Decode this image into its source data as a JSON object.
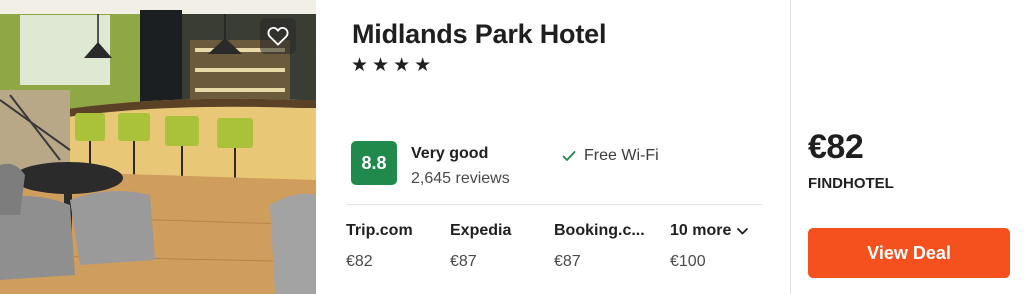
{
  "hotel": {
    "name": "Midlands Park Hotel",
    "stars_display": "★★★★",
    "star_count": 4
  },
  "rating": {
    "score": "8.8",
    "label": "Very good",
    "reviews": "2,645 reviews",
    "badge_color": "#1f8a4c"
  },
  "amenities": [
    {
      "label": "Free Wi-Fi",
      "icon": "check-icon"
    }
  ],
  "providers": [
    {
      "name": "Trip.com",
      "price": "€82"
    },
    {
      "name": "Expedia",
      "price": "€87"
    },
    {
      "name": "Booking.c...",
      "price": "€87"
    }
  ],
  "more_providers": {
    "label": "10 more",
    "price": "€100",
    "icon": "chevron-down-icon"
  },
  "best_deal": {
    "price": "€82",
    "provider": "FINDHOTEL",
    "button_label": "View Deal",
    "button_color": "#f4511e"
  },
  "icons": {
    "favorite": "heart-outline-icon"
  }
}
